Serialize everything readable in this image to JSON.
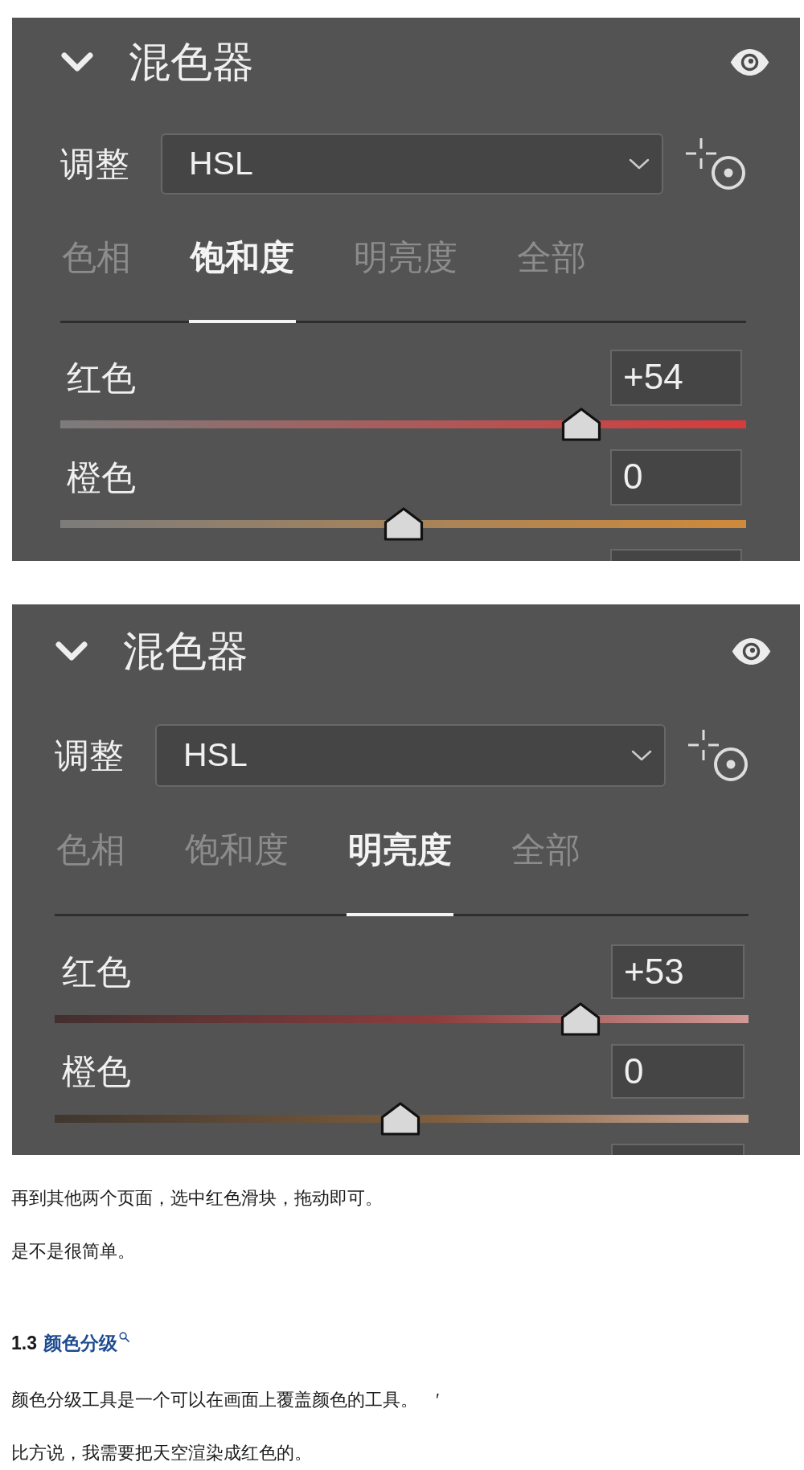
{
  "panels": [
    {
      "title": "混色器",
      "expanded": true,
      "adjust_label": "调整",
      "dropdown_value": "HSL",
      "tabs": [
        {
          "label": "色相",
          "selected": false
        },
        {
          "label": "饱和度",
          "selected": true
        },
        {
          "label": "明亮度",
          "selected": false
        },
        {
          "label": "全部",
          "selected": false
        }
      ],
      "sliders": [
        {
          "kind": "slider",
          "label": "红色",
          "value": "+54",
          "level": 0.76,
          "color": "#d73b3b"
        },
        {
          "kind": "slider",
          "label": "橙色",
          "value": "0",
          "level": 0.5,
          "color": "#cf8a3a"
        },
        {
          "kind": "clipped"
        }
      ]
    },
    {
      "title": "混色器",
      "expanded": true,
      "adjust_label": "调整",
      "dropdown_value": "HSL",
      "tabs": [
        {
          "label": "色相",
          "selected": false
        },
        {
          "label": "饱和度",
          "selected": false
        },
        {
          "label": "明亮度",
          "selected": true
        },
        {
          "label": "全部",
          "selected": false
        }
      ],
      "sliders": [
        {
          "kind": "slider",
          "label": "红色",
          "value": "+53",
          "level": 0.758,
          "color": "#8c3e3e"
        },
        {
          "kind": "slider",
          "label": "橙色",
          "value": "0",
          "level": 0.498,
          "color": "#7e5e3e"
        },
        {
          "kind": "clipped"
        }
      ]
    }
  ],
  "content": [
    {
      "kind": "paragraph",
      "text": "再到其他两个页面，选中红色滑块，拖动即可。"
    },
    {
      "kind": "paragraph",
      "text": "是不是很简单。"
    },
    {
      "kind": "heading",
      "number": "1.3",
      "link": "颜色分级"
    },
    {
      "kind": "paragraph",
      "text": "颜色分级工具是一个可以在画面上覆盖颜色的工具。　′"
    },
    {
      "kind": "paragraph",
      "text": "比方说，我需要把天空渲染成红色的。"
    }
  ]
}
